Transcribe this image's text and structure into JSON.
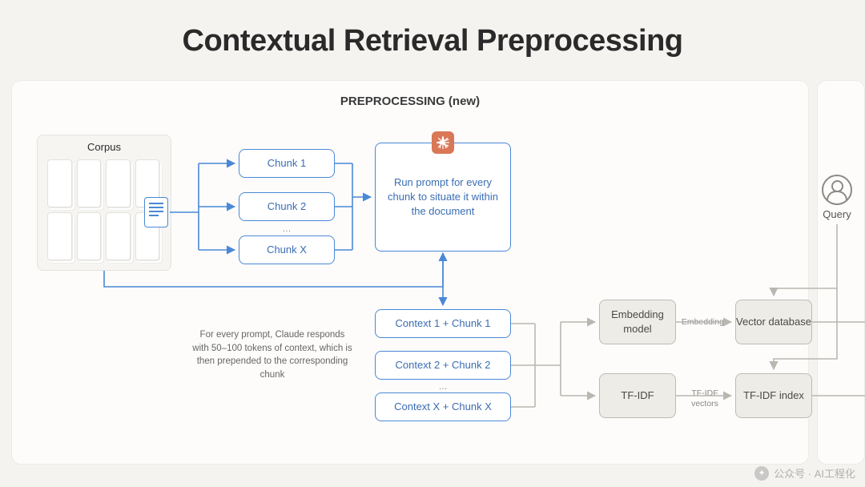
{
  "title": "Contextual Retrieval Preprocessing",
  "section_label": "PREPROCESSING (new)",
  "corpus": {
    "label": "Corpus"
  },
  "chunks": {
    "c1": "Chunk 1",
    "c2": "Chunk 2",
    "ellipsis": "…",
    "cx": "Chunk X"
  },
  "prompt_box": "Run prompt for every chunk to situate it within the document",
  "contexts": {
    "c1": "Context 1 + Chunk 1",
    "c2": "Context 2 + Chunk 2",
    "ellipsis": "…",
    "cx": "Context X + Chunk X"
  },
  "caption": "For every prompt, Claude responds with 50–100 tokens of context, which is then prepended to the corresponding chunk",
  "nodes": {
    "embedding_model": "Embedding model",
    "tfidf": "TF-IDF",
    "vector_db": "Vector database",
    "tfidf_index": "TF-IDF index"
  },
  "edge_labels": {
    "embeddings": "Embeddings",
    "tfidf_vectors": "TF-IDF vectors"
  },
  "query": {
    "label": "Query"
  },
  "watermark": "公众号 · AI工程化"
}
